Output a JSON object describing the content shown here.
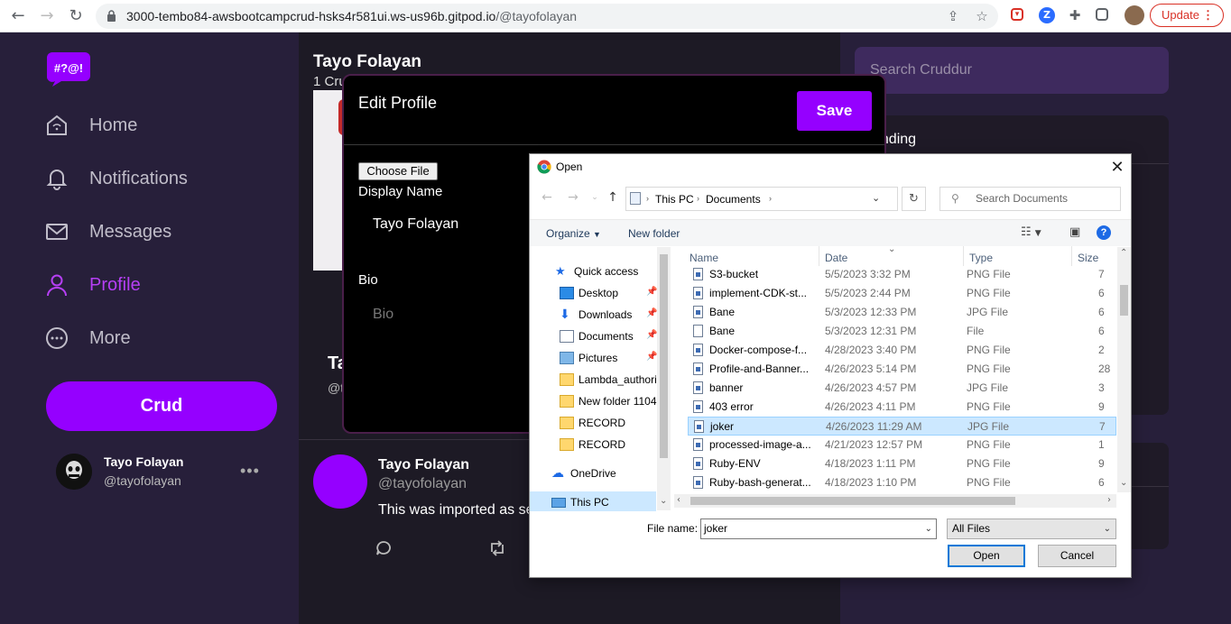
{
  "browser": {
    "url_host": "3000-tembo84-awsbootcampcrud-hsks4r581ui.ws-us96b.gitpod.io",
    "url_path": "/@tayofolayan",
    "update_label": "Update"
  },
  "sidebar": {
    "logo_text": "#?@!",
    "items": [
      {
        "label": "Home",
        "icon": "home-icon",
        "active": false
      },
      {
        "label": "Notifications",
        "icon": "bell-icon",
        "active": false
      },
      {
        "label": "Messages",
        "icon": "mail-icon",
        "active": false
      },
      {
        "label": "Profile",
        "icon": "user-icon",
        "active": true
      },
      {
        "label": "More",
        "icon": "more-icon",
        "active": false
      }
    ],
    "crud_label": "Crud",
    "me": {
      "name": "Tayo Folayan",
      "handle": "@tayofolayan"
    }
  },
  "main": {
    "profile_name": "Tayo Folayan",
    "profile_count": "1 Cru",
    "name_fragment": "Ta",
    "handle_fragment": "@t",
    "post": {
      "name": "Tayo Folayan",
      "handle": "@tayofolayan",
      "body": "This was imported as se"
    }
  },
  "right": {
    "search_placeholder": "Search Cruddur",
    "trending_title": "ending"
  },
  "edit_profile": {
    "title": "Edit Profile",
    "save_label": "Save",
    "choose_file_label": "Choose File",
    "display_name_label": "Display Name",
    "display_name_value": "Tayo Folayan",
    "bio_label": "Bio",
    "bio_placeholder": "Bio"
  },
  "open_dialog": {
    "title": "Open",
    "breadcrumb": [
      "This PC",
      "Documents"
    ],
    "search_placeholder": "Search Documents",
    "organize_label": "Organize",
    "new_folder_label": "New folder",
    "nav_items": [
      {
        "label": "Quick access",
        "kind": "star"
      },
      {
        "label": "Desktop",
        "kind": "desktop",
        "pinned": true
      },
      {
        "label": "Downloads",
        "kind": "download",
        "pinned": true
      },
      {
        "label": "Documents",
        "kind": "document",
        "pinned": true
      },
      {
        "label": "Pictures",
        "kind": "pictures",
        "pinned": true
      },
      {
        "label": "Lambda_authori",
        "kind": "folder"
      },
      {
        "label": "New folder 1104",
        "kind": "folder"
      },
      {
        "label": "RECORD",
        "kind": "folder"
      },
      {
        "label": "RECORD",
        "kind": "folder"
      },
      {
        "label": "OneDrive",
        "kind": "cloud"
      },
      {
        "label": "This PC",
        "kind": "pc"
      }
    ],
    "columns": [
      "Name",
      "Date",
      "Type",
      "Size"
    ],
    "files": [
      {
        "name": "S3-bucket",
        "date": "5/5/2023 3:32 PM",
        "type": "PNG File",
        "size": "7"
      },
      {
        "name": "implement-CDK-st...",
        "date": "5/5/2023 2:44 PM",
        "type": "PNG File",
        "size": "6"
      },
      {
        "name": "Bane",
        "date": "5/3/2023 12:33 PM",
        "type": "JPG File",
        "size": "6"
      },
      {
        "name": "Bane",
        "date": "5/3/2023 12:31 PM",
        "type": "File",
        "size": "6"
      },
      {
        "name": "Docker-compose-f...",
        "date": "4/28/2023 3:40 PM",
        "type": "PNG File",
        "size": "2"
      },
      {
        "name": "Profile-and-Banner...",
        "date": "4/26/2023 5:14 PM",
        "type": "PNG File",
        "size": "28"
      },
      {
        "name": "banner",
        "date": "4/26/2023 4:57 PM",
        "type": "JPG File",
        "size": "3"
      },
      {
        "name": "403 error",
        "date": "4/26/2023 4:11 PM",
        "type": "PNG File",
        "size": "9"
      },
      {
        "name": "joker",
        "date": "4/26/2023 11:29 AM",
        "type": "JPG File",
        "size": "7",
        "selected": true
      },
      {
        "name": "processed-image-a...",
        "date": "4/21/2023 12:57 PM",
        "type": "PNG File",
        "size": "1"
      },
      {
        "name": "Ruby-ENV",
        "date": "4/18/2023 1:11 PM",
        "type": "PNG File",
        "size": "9"
      },
      {
        "name": "Ruby-bash-generat...",
        "date": "4/18/2023 1:10 PM",
        "type": "PNG File",
        "size": "6"
      }
    ],
    "file_name_label": "File name:",
    "file_name_value": "joker",
    "filter_value": "All Files",
    "open_label": "Open",
    "cancel_label": "Cancel"
  },
  "colors": {
    "accent": "#9500ff",
    "sidebar_bg": "#271f3a",
    "main_bg": "#1d1a25"
  }
}
